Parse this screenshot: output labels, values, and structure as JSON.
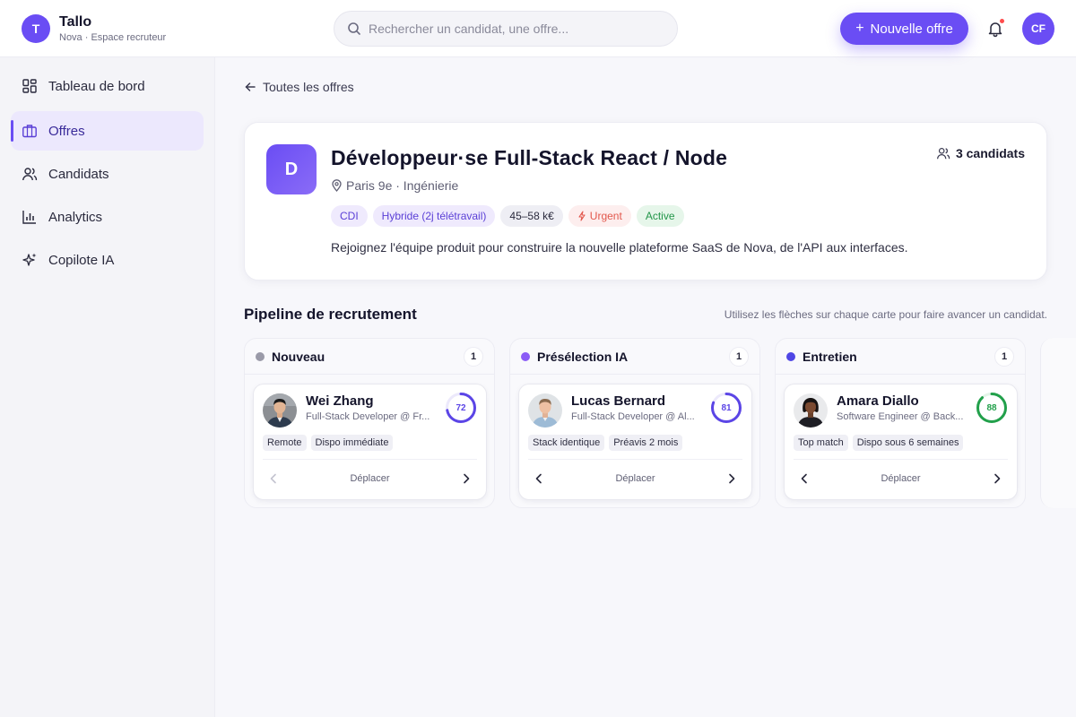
{
  "app": {
    "logo_letter": "T",
    "name": "Tallo",
    "subtitle": "Nova · Espace recruteur",
    "accent": "#6a4df4"
  },
  "header": {
    "search_placeholder": "Rechercher un candidat, une offre...",
    "new_offer_label": "Nouvelle offre",
    "new_offer_icon": "plus-icon",
    "notification_icon": "bell-icon",
    "user_initials": "CF"
  },
  "sidebar": {
    "items": [
      {
        "label": "Tableau de bord",
        "icon": "dashboard-icon",
        "active": false
      },
      {
        "label": "Offres",
        "icon": "briefcase-icon",
        "active": true
      },
      {
        "label": "Candidats",
        "icon": "users-icon",
        "active": false
      },
      {
        "label": "Analytics",
        "icon": "bar-chart-icon",
        "active": false
      },
      {
        "label": "Copilote IA",
        "icon": "sparkles-icon",
        "active": false
      }
    ]
  },
  "main": {
    "back_label": "Toutes les offres",
    "job": {
      "logo_letter": "D",
      "title": "Développeur·se Full-Stack React / Node",
      "location": "Paris 9e · Ingénierie",
      "candidates_count": "3 candidats",
      "tags": {
        "contract": "CDI",
        "remote": "Hybride (2j télétravail)",
        "salary": "45–58 k€",
        "urgent": "Urgent",
        "status": "Active"
      },
      "description": "Rejoignez l'équipe produit pour construire la nouvelle plateforme SaaS de Nova, de l'API aux interfaces."
    },
    "pipeline": {
      "title": "Pipeline de recrutement",
      "hint": "Utilisez les flèches sur chaque carte pour faire avancer un candidat.",
      "columns": [
        {
          "name": "Nouveau",
          "count": "1",
          "color": "#9a9aa8",
          "card": {
            "name": "Wei Zhang",
            "role": "Full-Stack Developer @ Fr...",
            "score": "72",
            "score_value": 72,
            "score_color": "#5b45e6",
            "chips": [
              "Remote",
              "Dispo immédiate"
            ],
            "move_label": "Déplacer",
            "can_move_back": false
          }
        },
        {
          "name": "Présélection IA",
          "count": "1",
          "color": "#8b5cf6",
          "card": {
            "name": "Lucas Bernard",
            "role": "Full-Stack Developer @ Al...",
            "score": "81",
            "score_value": 81,
            "score_color": "#5b45e6",
            "chips": [
              "Stack identique",
              "Préavis 2 mois"
            ],
            "move_label": "Déplacer",
            "can_move_back": true
          }
        },
        {
          "name": "Entretien",
          "count": "1",
          "color": "#4f46e5",
          "card": {
            "name": "Amara Diallo",
            "role": "Software Engineer @ Back...",
            "score": "88",
            "score_value": 88,
            "score_color": "#22a04b",
            "chips": [
              "Top match",
              "Dispo sous 6 semaines"
            ],
            "move_label": "Déplacer",
            "can_move_back": true
          }
        }
      ]
    }
  }
}
